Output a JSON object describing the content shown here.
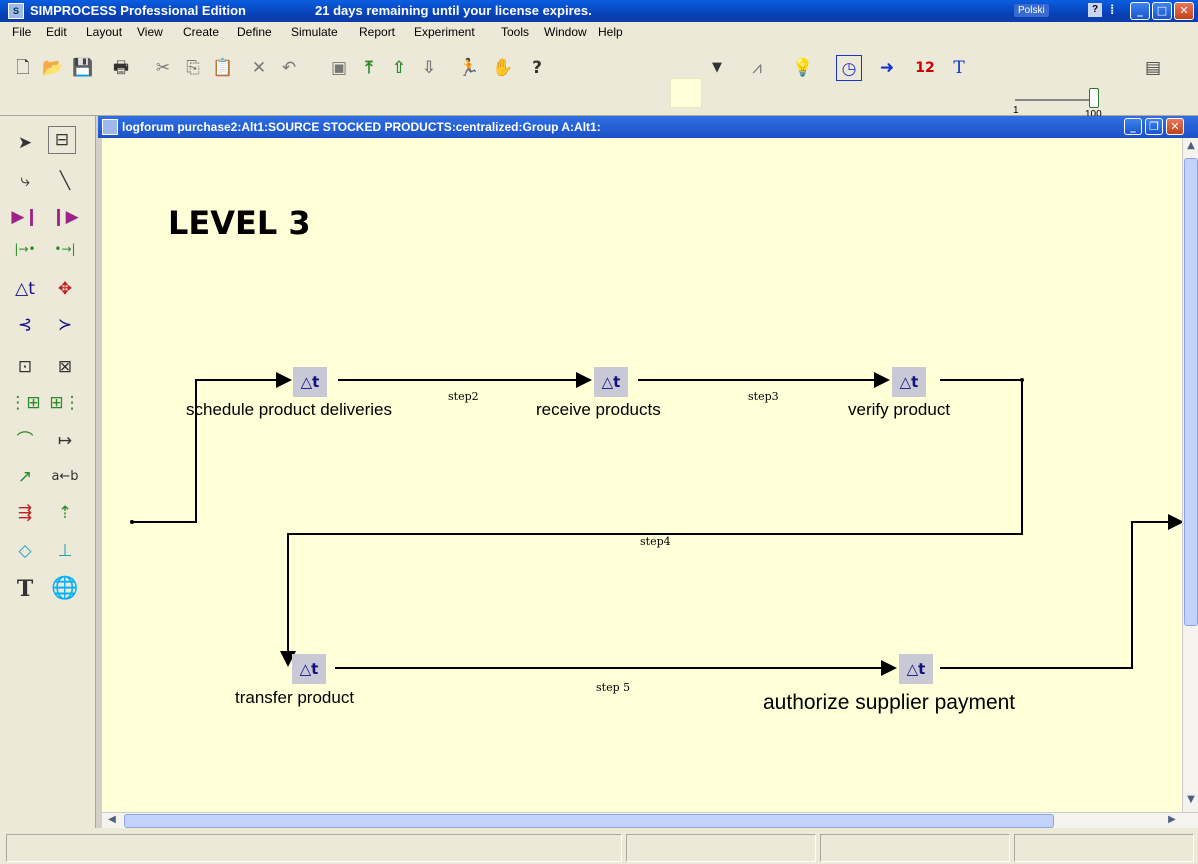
{
  "window": {
    "title": "SIMPROCESS Professional Edition",
    "license_notice": "21 days remaining until your license expires.",
    "language": "Polski"
  },
  "menu": [
    "File",
    "Edit",
    "Layout",
    "View",
    "Create",
    "Define",
    "Simulate",
    "Report",
    "Experiment",
    "Tools",
    "Window",
    "Help"
  ],
  "toolbar": {
    "icons": [
      "new-file",
      "open-folder",
      "save",
      "print",
      "cut",
      "copy",
      "paste",
      "delete",
      "undo",
      "properties",
      "move-to-top",
      "move-up",
      "move-down",
      "run",
      "stop",
      "help",
      "fill-color",
      "dropdown",
      "chart",
      "lightbulb",
      "clock",
      "speed",
      "calendar",
      "text-style",
      "speed-slider",
      "film"
    ],
    "speed_slider": {
      "min": "1",
      "max": "100",
      "value": 100
    }
  },
  "document": {
    "title": "logforum purchase2:Alt1:SOURCE STOCKED PRODUCTS:centralized:Group A:Alt1:"
  },
  "diagram": {
    "level_title": "LEVEL 3",
    "activity_icon": "△t",
    "activities": [
      {
        "label": "schedule product deliveries"
      },
      {
        "label": "receive products"
      },
      {
        "label": "verify product"
      },
      {
        "label": "transfer product"
      },
      {
        "label": "authorize supplier payment"
      }
    ],
    "connectors": [
      "step2",
      "step3",
      "step4",
      "step 5"
    ]
  }
}
